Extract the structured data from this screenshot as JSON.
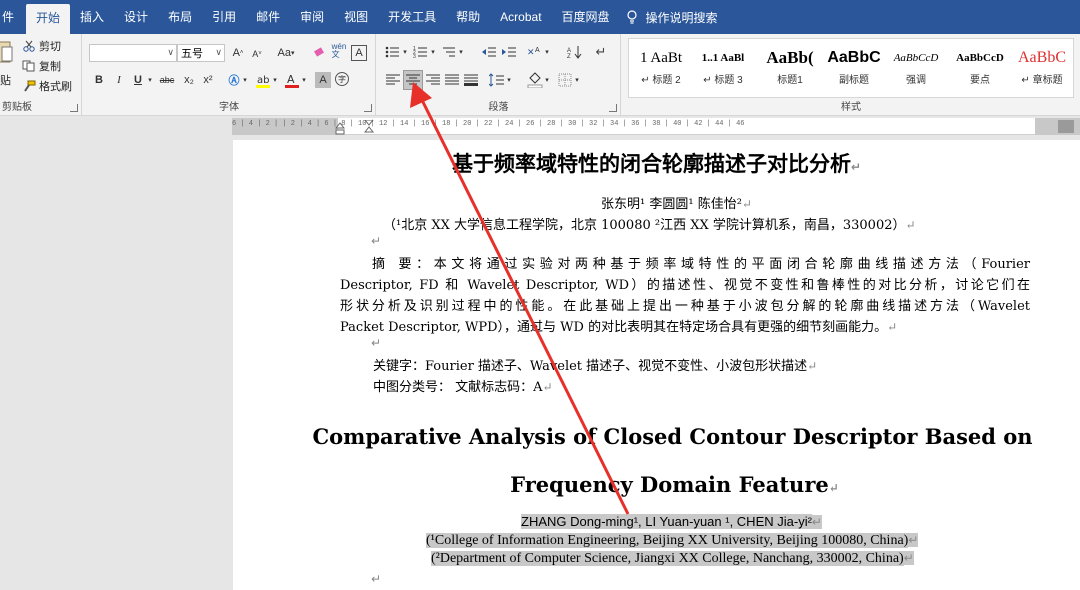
{
  "tabs": [
    "件",
    "开始",
    "插入",
    "设计",
    "布局",
    "引用",
    "邮件",
    "审阅",
    "视图",
    "开发工具",
    "帮助",
    "Acrobat",
    "百度网盘"
  ],
  "active_tab": "开始",
  "tell_me": "操作说明搜索",
  "clipboard": {
    "cut": "剪切",
    "copy": "复制",
    "paste_partial": "贴",
    "format_painter": "格式刷",
    "label": "剪贴板"
  },
  "font": {
    "name_value": "",
    "size_value": "五号",
    "grow": "A",
    "shrink": "A",
    "case": "Aa",
    "bold": "B",
    "italic": "I",
    "underline": "U",
    "strike": "abc",
    "subscript": "x₂",
    "superscript": "x²",
    "label": "字体"
  },
  "paragraph": {
    "label": "段落"
  },
  "styles": {
    "label": "样式",
    "items": [
      {
        "sample": "1  AaBt",
        "name": "↵ 标题 2"
      },
      {
        "sample": "1..1  AaBl",
        "name": "↵ 标题 3"
      },
      {
        "sample": "AaBb(",
        "name": "标题1"
      },
      {
        "sample": "AaBbC",
        "name": "副标题"
      },
      {
        "sample": "AaBbCcD",
        "name": "强调"
      },
      {
        "sample": "AaBbCcD",
        "name": "要点"
      },
      {
        "sample": "AaBbC",
        "name": "↵ 章标题"
      }
    ]
  },
  "ruler_text": "6 | 4 | 2 |   | 2 | 4 | 6 | 8 | 10 | 12 | 14 | 16 | 18 | 20 | 22 | 24 | 26 | 28 | 30 | 32 | 34 | 36 | 38 | 40 | 42 | 44 | 46",
  "doc": {
    "title_cn": "基于频率域特性的闭合轮廓描述子对比分析",
    "authors_cn": "张东明¹  李圆圆¹  陈佳怡²",
    "affil_cn": "（¹北京 XX 大学信息工程学院，北京  100080      ²江西 XX 学院计算机系，南昌，330002）",
    "abstract_lines": [
      "摘    要：本文将通过实验对两种基于频率域特性的平面闭合轮廓曲线描述方法（Fourier",
      "Descriptor, FD 和 Wavelet Descriptor, WD）的描述性、视觉不变性和鲁棒性的对比分析，讨论它们在",
      "形状分析及识别过程中的性能。在此基础上提出一种基于小波包分解的轮廓曲线描述方法（Wavelet",
      "Packet  Descriptor,  WPD），通过与  WD  的对比表明其在特定场合具有更强的细节刻画能力。"
    ],
    "keywords": "关键字：Fourier 描述子、Wavelet 描述子、视觉不变性、小波包形状描述",
    "classification": "中图分类号：                文献标志码：A",
    "title_en_1": "Comparative Analysis of Closed Contour Descriptor Based on",
    "title_en_2": "Frequency Domain Feature",
    "authors_en": "ZHANG Dong-ming¹, LI Yuan-yuan ¹, CHEN Jia-yi²",
    "affil_en_1": "(¹College of Information Engineering, Beijing XX University, Beijing 100080, China)",
    "affil_en_2": "(²Department of Computer Science, Jiangxi XX College, Nanchang, 330002, China)"
  },
  "colors": {
    "tabbar": "#2b579a",
    "arrow": "#e8302a",
    "highlight": "#c8c8c8"
  }
}
